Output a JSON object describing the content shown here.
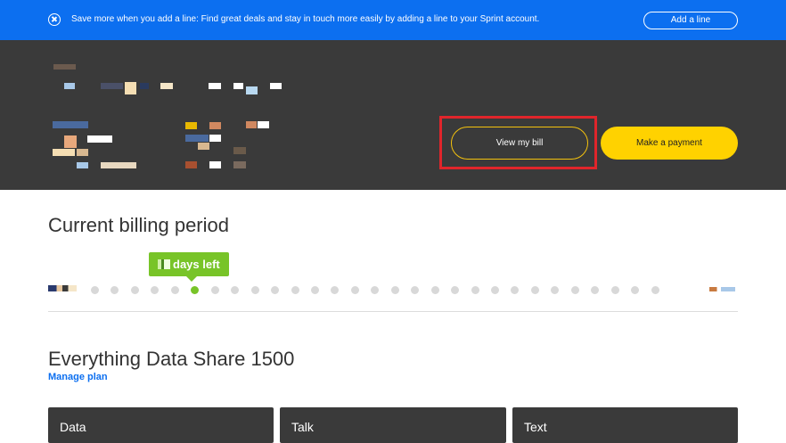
{
  "banner": {
    "message": "Save more when you add a line: Find great deals and stay in touch more easily by adding a line to your Sprint account.",
    "add_line_label": "Add a line"
  },
  "account": {
    "view_bill_label": "View my bill",
    "make_payment_label": "Make a payment"
  },
  "billing": {
    "title": "Current billing period",
    "days_left_label": "days left",
    "total_days": 31,
    "current_day": 6
  },
  "plan": {
    "name": "Everything Data Share 1500",
    "manage_label": "Manage plan"
  },
  "cards": [
    {
      "label": "Data"
    },
    {
      "label": "Talk"
    },
    {
      "label": "Text"
    }
  ],
  "colors": {
    "brand_blue": "#0c6ff0",
    "accent_yellow": "#ffd200",
    "progress_green": "#78c428",
    "highlight_red": "#e0252b"
  }
}
